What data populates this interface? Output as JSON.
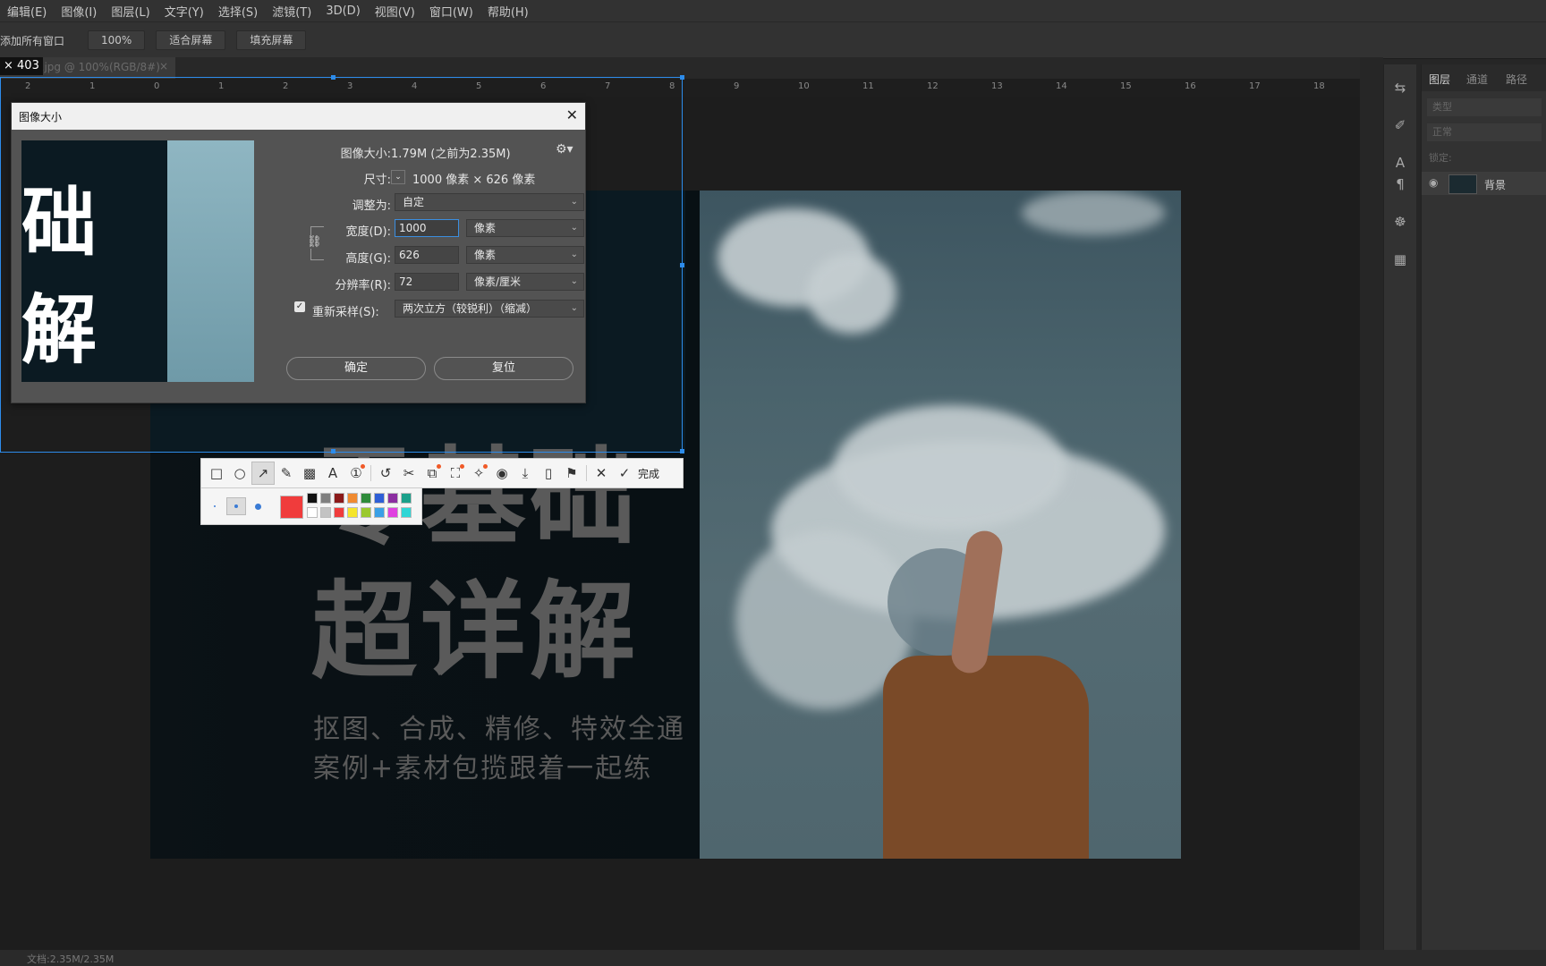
{
  "menubar": {
    "items": [
      "编辑(E)",
      "图像(I)",
      "图层(L)",
      "文字(Y)",
      "选择(S)",
      "滤镜(T)",
      "3D(D)",
      "视图(V)",
      "窗口(W)",
      "帮助(H)"
    ]
  },
  "options_bar": {
    "label": "添加所有窗口",
    "zoom": "100%",
    "fit_screen": "适合屏幕",
    "fill_screen": "填充屏幕"
  },
  "doc_tab": {
    "title": "2.jpg @ 100%(RGB/8#)",
    "close": "×"
  },
  "size_badge": "× 403",
  "ruler": {
    "ticks": [
      "2",
      "1",
      "0",
      "1",
      "2",
      "3",
      "4",
      "5",
      "6",
      "7",
      "8",
      "9",
      "10",
      "11",
      "12",
      "13",
      "14",
      "15",
      "16",
      "17",
      "18"
    ]
  },
  "canvas": {
    "headline_top": "零基础",
    "headline_main": "超详解",
    "sub_line1": "抠图、合成、精修、特效全通",
    "sub_line2": "案例+素材包揽跟着一起练"
  },
  "dialog": {
    "title": "图像大小",
    "close": "✕",
    "preview_chars": [
      "础",
      "解"
    ],
    "image_size_label": "图像大小:",
    "image_size_value": "1.79M (之前为2.35M)",
    "dimensions_label": "尺寸:",
    "dimensions_value": "1000 像素 × 626 像素",
    "fit_label": "调整为:",
    "fit_value": "自定",
    "width_label": "宽度(D):",
    "width_value": "1000",
    "width_unit": "像素",
    "height_label": "高度(G):",
    "height_value": "626",
    "height_unit": "像素",
    "resolution_label": "分辨率(R):",
    "resolution_value": "72",
    "resolution_unit": "像素/厘米",
    "resample_label": "重新采样(S):",
    "resample_value": "两次立方（较锐利）（缩减）",
    "resample_checked": true,
    "ok_label": "确定",
    "reset_label": "复位"
  },
  "snap_toolbar": {
    "done_label": "完成",
    "tools": [
      "rectangle-icon",
      "ellipse-icon",
      "arrow-icon",
      "pencil-icon",
      "mosaic-icon",
      "text-icon",
      "number-icon",
      "undo-icon",
      "crop-icon",
      "pin-icon",
      "ocr-icon",
      "translate-icon",
      "record-icon",
      "download-icon",
      "save-icon",
      "bookmark-icon",
      "cancel-icon",
      "check-icon"
    ],
    "current_color": "#f03c3c",
    "colors_top": [
      "#111111",
      "#7f7f7f",
      "#8b1a1a",
      "#f08a30",
      "#2e8b3a",
      "#2e5fd6",
      "#8b2ea0",
      "#1aa08a"
    ],
    "colors_bottom": [
      "#ffffff",
      "#c3c3c3",
      "#f03c3c",
      "#f5e52a",
      "#9ac92e",
      "#3aa0e6",
      "#e040e0",
      "#2ed6d6"
    ]
  },
  "right_panel": {
    "tabs": [
      "图层",
      "通道",
      "路径"
    ],
    "search_placeholder": "类型",
    "mode": "正常",
    "lock_label": "锁定:",
    "layer_name": "背景"
  },
  "status_bar": {
    "doc_info": "文档:2.35M/2.35M"
  },
  "colors": {
    "selection": "#2d8ceb",
    "accent_red": "#f05a28"
  }
}
